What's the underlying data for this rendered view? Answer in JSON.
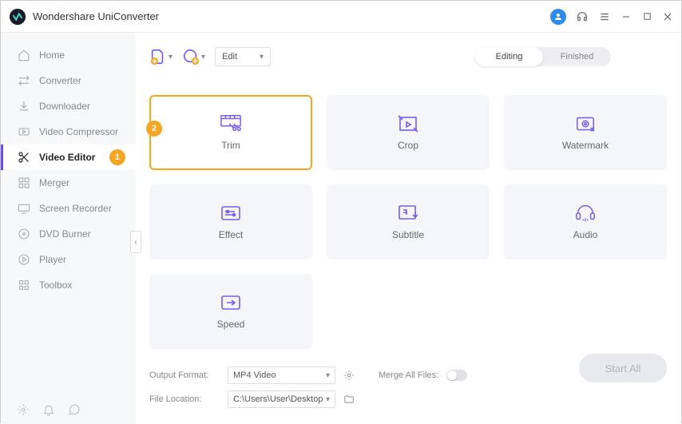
{
  "app": {
    "title": "Wondershare UniConverter"
  },
  "titlebar": {
    "avatar_letter": ""
  },
  "sidebar": {
    "items": [
      {
        "label": "Home"
      },
      {
        "label": "Converter"
      },
      {
        "label": "Downloader"
      },
      {
        "label": "Video Compressor"
      },
      {
        "label": "Video Editor",
        "active": true,
        "badge": "1"
      },
      {
        "label": "Merger"
      },
      {
        "label": "Screen Recorder"
      },
      {
        "label": "DVD Burner"
      },
      {
        "label": "Player"
      },
      {
        "label": "Toolbox"
      }
    ]
  },
  "toolbar": {
    "edit_dropdown": "Edit",
    "seg_editing": "Editing",
    "seg_finished": "Finished"
  },
  "cards": {
    "trim": {
      "label": "Trim",
      "badge": "2"
    },
    "crop": {
      "label": "Crop"
    },
    "watermark": {
      "label": "Watermark"
    },
    "effect": {
      "label": "Effect"
    },
    "subtitle": {
      "label": "Subtitle"
    },
    "audio": {
      "label": "Audio"
    },
    "speed": {
      "label": "Speed"
    }
  },
  "footer": {
    "output_format_label": "Output Format:",
    "output_format_value": "MP4 Video",
    "file_location_label": "File Location:",
    "file_location_value": "C:\\Users\\User\\Desktop",
    "merge_label": "Merge All Files:",
    "start_button": "Start All"
  }
}
